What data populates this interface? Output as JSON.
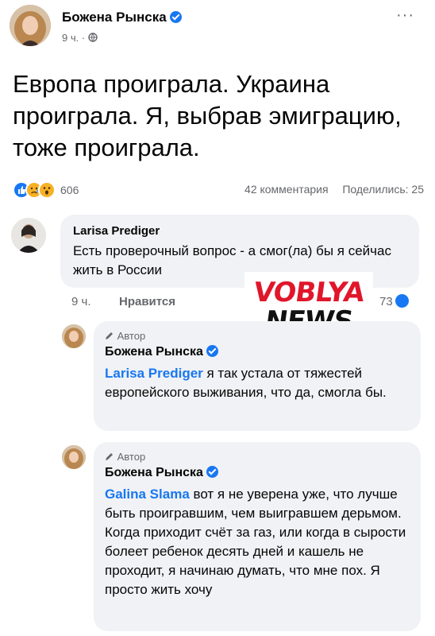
{
  "post": {
    "author": "Божена Рынска",
    "time": "9 ч. ·",
    "menu": "···",
    "text": "Европа проиграла. Украина проиграла. Я, выбрав эмиграцию, тоже проиграла.",
    "reaction_count": "606",
    "comments": "42 комментария",
    "shares": "Поделились: 25"
  },
  "comments": [
    {
      "name": "Larisa Prediger",
      "text": "Есть проверочный вопрос - а смог(ла) бы я сейчас жить в России",
      "time": "9 ч.",
      "like_label": "Нравится",
      "likes": "73"
    }
  ],
  "replies": [
    {
      "tag": "Автор",
      "name": "Божена Рынска",
      "mention": "Larisa Prediger",
      "text": " я так устала от тяжестей европейского выживания, что да, смогла бы."
    },
    {
      "tag": "Автор",
      "name": "Божена Рынска",
      "mention": "Galina Slama",
      "text": " вот я не уверена уже, что лучше быть проигравшим, чем выигравшем дерьмом. Когда приходит счёт за газ, или когда в сырости болеет ребенок десять дней и кашель не проходит, я начинаю думать, что мне пох. Я просто жить хочу"
    }
  ],
  "watermark": {
    "line1": "VOBLYA",
    "line2": "NEWS"
  },
  "colors": {
    "accent": "#1877f2",
    "bubble": "#f0f2f5",
    "secondary_text": "#65676b"
  }
}
